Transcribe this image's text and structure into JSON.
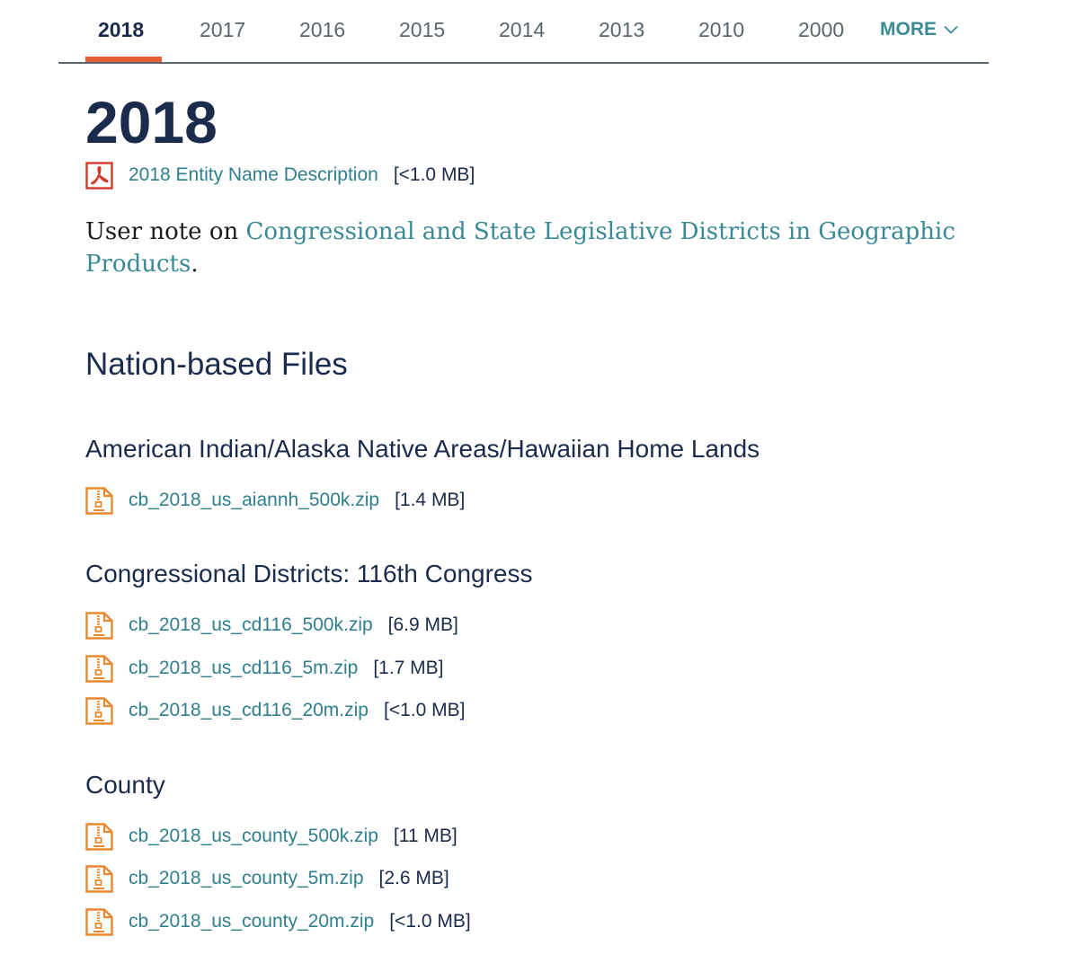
{
  "tabs": [
    {
      "label": "2018",
      "active": true
    },
    {
      "label": "2017"
    },
    {
      "label": "2016"
    },
    {
      "label": "2015"
    },
    {
      "label": "2014"
    },
    {
      "label": "2013"
    },
    {
      "label": "2010"
    },
    {
      "label": "2000"
    }
  ],
  "tabs_more_label": "MORE",
  "page": {
    "title": "2018",
    "entity_doc": {
      "label": "2018 Entity Name Description",
      "size": "[<1.0 MB]",
      "icon": "pdf-icon"
    },
    "note": {
      "prefix": "User note on ",
      "link": "Congressional and State Legislative Districts in Geographic Products",
      "suffix": "."
    }
  },
  "section": {
    "title": "Nation-based Files",
    "groups": [
      {
        "title": "American Indian/Alaska Native Areas/Hawaiian Home Lands",
        "files": [
          {
            "name": "cb_2018_us_aiannh_500k.zip",
            "size": "[1.4 MB]"
          }
        ]
      },
      {
        "title": "Congressional Districts: 116th Congress",
        "files": [
          {
            "name": "cb_2018_us_cd116_500k.zip",
            "size": "[6.9 MB]"
          },
          {
            "name": "cb_2018_us_cd116_5m.zip",
            "size": "[1.7 MB]"
          },
          {
            "name": "cb_2018_us_cd116_20m.zip",
            "size": "[<1.0 MB]"
          }
        ]
      },
      {
        "title": "County",
        "files": [
          {
            "name": "cb_2018_us_county_500k.zip",
            "size": "[11 MB]"
          },
          {
            "name": "cb_2018_us_county_5m.zip",
            "size": "[2.6 MB]"
          },
          {
            "name": "cb_2018_us_county_20m.zip",
            "size": "[<1.0 MB]"
          }
        ]
      }
    ]
  },
  "icons": {
    "file": "zip-file-icon",
    "more": "chevron-down-icon"
  },
  "colors": {
    "accent": "#e35f32",
    "link": "#2f7f8c",
    "text": "#1b2b4b",
    "pdf": "#d3392c",
    "zip": "#e8892f"
  }
}
